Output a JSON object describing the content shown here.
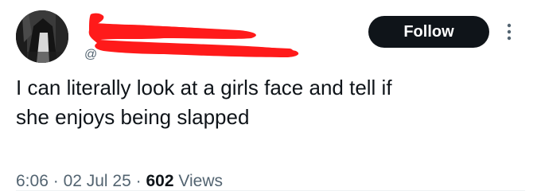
{
  "author": {
    "handle_prefix": "@"
  },
  "follow_button": {
    "label": "Follow"
  },
  "tweet": {
    "text_line1": "I can literally look at a girls face and tell if",
    "text_line2": "she enjoys being slapped"
  },
  "meta": {
    "time": "6:06",
    "separator": "·",
    "date": "02 Jul 25",
    "views_count": "602",
    "views_label": "Views"
  },
  "colors": {
    "redaction": "#ff1a1a",
    "follow_bg": "#0f1419",
    "secondary_text": "#536471"
  },
  "icons": {
    "more": "more-vertical-icon"
  }
}
